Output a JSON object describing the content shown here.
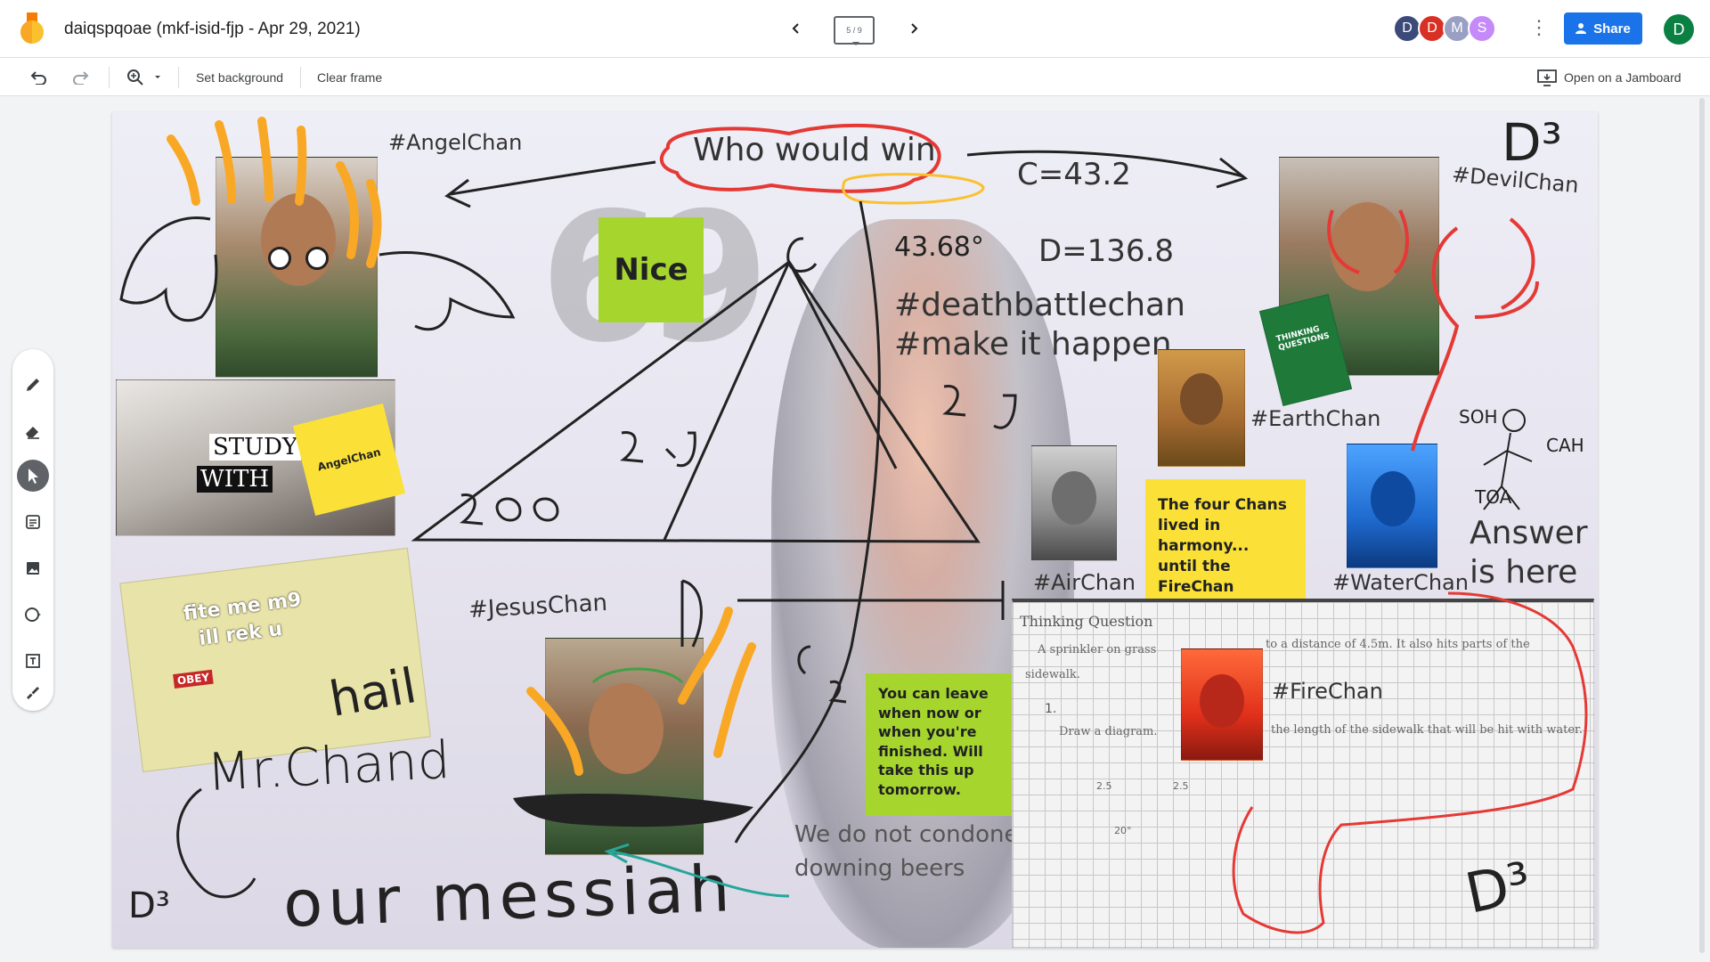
{
  "header": {
    "title": "daiqspqoae (mkf-isid-fjp - Apr 29, 2021)",
    "frame_indicator": "5 / 9",
    "avatars": [
      {
        "letter": "D",
        "color": "#3c4a7a"
      },
      {
        "letter": "D",
        "color": "#d93025"
      },
      {
        "letter": "M",
        "color": "#9aa0c4"
      },
      {
        "letter": "S",
        "color": "#c58af9"
      }
    ],
    "share_label": "Share",
    "user_initial": "D"
  },
  "toolbar": {
    "set_background": "Set background",
    "clear_frame": "Clear frame",
    "open_jamboard": "Open on a Jamboard"
  },
  "canvas": {
    "angel_tag": "#AngelChan",
    "who_would_win": "Who would win",
    "c_value": "C=43.2",
    "d_value": "D=136.8",
    "devil_tag": "#DevilChan",
    "deathbattle": "#deathbattlechan",
    "make_it_happen": "#make it happen",
    "earth_tag": "#EarthChan",
    "air_tag": "#AirChan",
    "water_tag": "#WaterChan",
    "answer_line1": "Answer",
    "answer_line2": "is here",
    "jesus_tag": "#JesusChan",
    "fire_tag": "#FireChan",
    "study_word1": "STUDY",
    "study_word2": "WITH",
    "angel_sticky": "AngelChan",
    "nice_sticky": "Nice",
    "four_chans_sticky": "The four Chans lived in harmony... until the FireChan attacked.",
    "leave_sticky": "You can leave when now or when you're finished. Will take this up tomorrow.",
    "condone_line1": "We do not condone",
    "condone_line2": "downing beers",
    "meme_text1": "fite me m9",
    "meme_text2": "ill rek u",
    "meme_badge": "OBEY",
    "book_text": "THINKING QUESTIONS",
    "hw_title": "Thinking Question",
    "hw_line1": "A sprinkler on grass",
    "hw_line2": "to a distance of 4.5m. It also hits parts of the",
    "hw_line3": "sidewalk.",
    "hw_step": "1.",
    "hw_line4": "Draw a diagram.",
    "hw_line5": "the length of the sidewalk that will be hit with water.",
    "hand_mrchand": "Mr.Chand",
    "hand_hail": "hail",
    "hand_our_messiah": "our messiah",
    "hand_soh": "SOH",
    "hand_cah": "CAH",
    "hand_toa": "TOA",
    "hand_d3": "D³",
    "hand_deg": "43.68°",
    "hand_20": "20°",
    "hand_25a": "2.5",
    "hand_25b": "2.5"
  }
}
